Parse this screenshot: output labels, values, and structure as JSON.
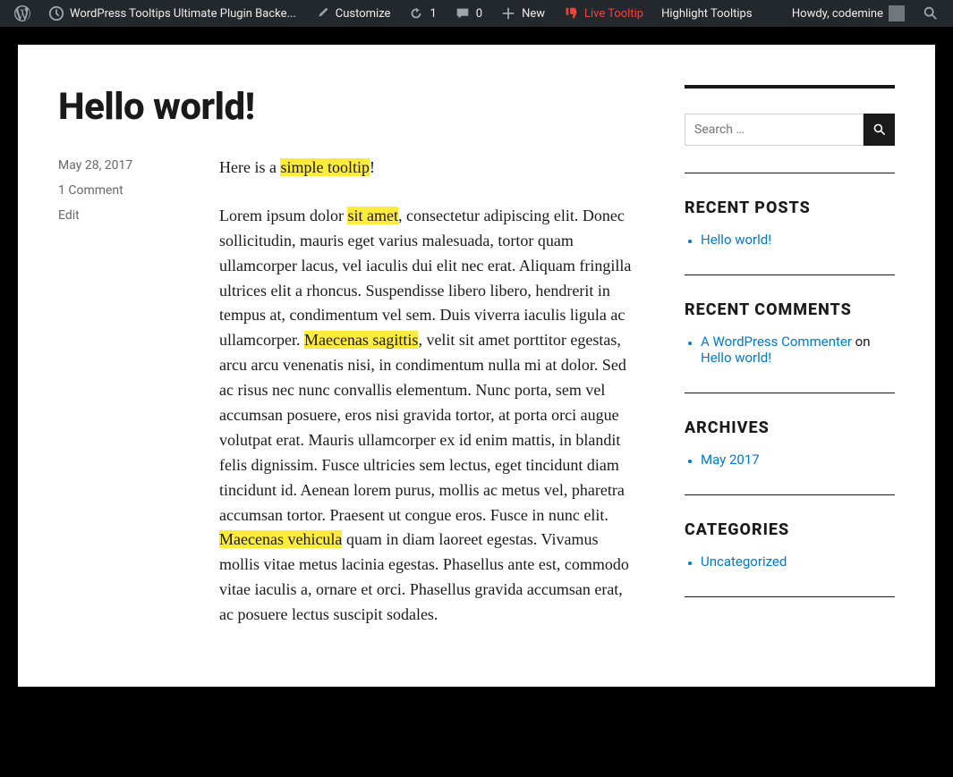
{
  "adminbar": {
    "site_title": "WordPress Tooltips Ultimate Plugin Backe...",
    "customize": "Customize",
    "updates": "1",
    "comments": "0",
    "new": "New",
    "live_tooltip": "Live Tooltip",
    "highlight_tooltips": "Highlight Tooltips",
    "howdy": "Howdy, codemine"
  },
  "post": {
    "title": "Hello world!",
    "meta": {
      "date": "May 28, 2017",
      "comments": "1 Comment",
      "edit": "Edit"
    },
    "intro_pre": "Here is a ",
    "intro_hl": "simple tooltip",
    "intro_post": "!",
    "p1_t1": "Lorem ipsum dolor ",
    "p1_h1": "sit amet",
    "p1_t2": ", consectetur adipiscing elit. Donec sollicitudin, mauris eget varius malesuada, tortor quam ullamcorper lacus, vel iaculis dui elit nec erat. Aliquam fringilla ultrices elit a rhoncus. Suspendisse libero libero, hendrerit in tempus at, condimentum vel sem. Duis viverra iaculis ligula ac ullamcorper. ",
    "p1_h2": "Maecenas sagittis",
    "p1_t3": ", velit sit amet porttitor egestas, arcu arcu venenatis nisi, in condimentum nulla mi at dolor. Sed ac risus nec nunc convallis elementum. Nunc porta, sem vel accumsan posuere, eros nisi gravida tortor, at porta orci augue volutpat erat. Mauris ullamcorper ex id enim mattis, in blandit felis dignissim. Fusce ultricies sem lectus, eget tincidunt diam tincidunt id. Aenean lorem purus, mollis ac metus vel, pharetra accumsan tortor. Praesent ut congue eros. Fusce in nunc elit. ",
    "p1_h3": "Maecenas vehicula",
    "p1_t4": " quam in diam laoreet egestas. Vivamus mollis vitae metus lacinia egestas. Phasellus ante est, commodo vitae iaculis a, ornare et orci. Phasellus gravida accumsan erat, ac posuere lectus suscipit sodales."
  },
  "sidebar": {
    "search_placeholder": "Search …",
    "recent_posts": {
      "heading": "RECENT POSTS",
      "items": [
        "Hello world!"
      ]
    },
    "recent_comments": {
      "heading": "RECENT COMMENTS",
      "commenter": "A WordPress Commenter",
      "on": " on ",
      "post": "Hello world!"
    },
    "archives": {
      "heading": "ARCHIVES",
      "items": [
        "May 2017"
      ]
    },
    "categories": {
      "heading": "CATEGORIES",
      "items": [
        "Uncategorized"
      ]
    }
  }
}
